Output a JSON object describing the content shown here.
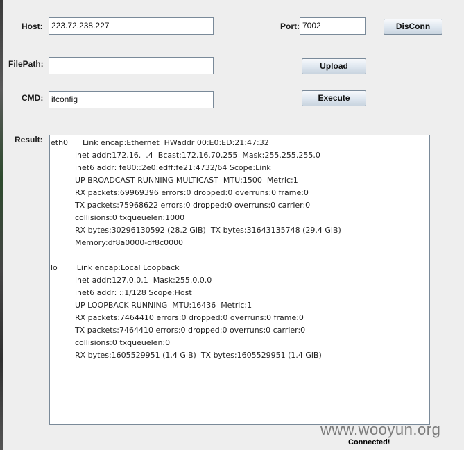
{
  "form": {
    "host_label": "Host:",
    "host_value": "223.72.238.227",
    "port_label": "Port:",
    "port_value": "7002",
    "disconnect_label": "DisConn",
    "filepath_label": "FilePath:",
    "filepath_value": "",
    "upload_label": "Upload",
    "cmd_label": "CMD:",
    "cmd_value": "ifconfig",
    "execute_label": "Execute",
    "result_label": "Result:"
  },
  "result": {
    "text": "eth0      Link encap:Ethernet  HWaddr 00:E0:ED:21:47:32\n          inet addr:172.16.  .4  Bcast:172.16.70.255  Mask:255.255.255.0\n          inet6 addr: fe80::2e0:edff:fe21:4732/64 Scope:Link\n          UP BROADCAST RUNNING MULTICAST  MTU:1500  Metric:1\n          RX packets:69969396 errors:0 dropped:0 overruns:0 frame:0\n          TX packets:75968622 errors:0 dropped:0 overruns:0 carrier:0\n          collisions:0 txqueuelen:1000\n          RX bytes:30296130592 (28.2 GiB)  TX bytes:31643135748 (29.4 GiB)\n          Memory:df8a0000-df8c0000\n\nlo        Link encap:Local Loopback\n          inet addr:127.0.0.1  Mask:255.0.0.0\n          inet6 addr: ::1/128 Scope:Host\n          UP LOOPBACK RUNNING  MTU:16436  Metric:1\n          RX packets:7464410 errors:0 dropped:0 overruns:0 frame:0\n          TX packets:7464410 errors:0 dropped:0 overruns:0 carrier:0\n          collisions:0 txqueuelen:0\n          RX bytes:1605529951 (1.4 GiB)  TX bytes:1605529951 (1.4 GiB)"
  },
  "watermark": "www.wooyun.org",
  "status": "Connected!"
}
